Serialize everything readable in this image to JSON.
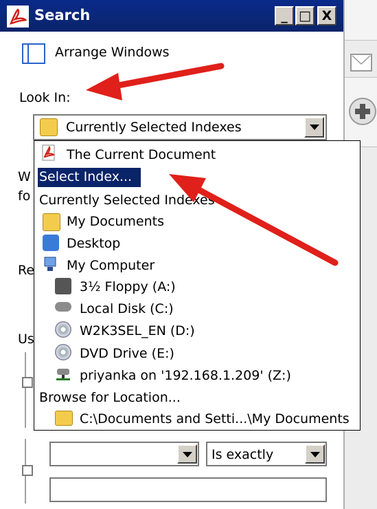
{
  "window": {
    "title": "Search",
    "minimize": "_",
    "maximize": "□",
    "close": "X"
  },
  "panel": {
    "arrange_windows": "Arrange Windows",
    "look_in_label": "Look In:",
    "look_in_value": "Currently Selected Indexes",
    "partial_labels": [
      "W",
      "fo",
      "Re",
      "Us"
    ]
  },
  "dropdown": {
    "items": [
      "The Current Document",
      "Select Index...",
      "Currently Selected Indexes",
      "My Documents",
      "Desktop",
      "My Computer",
      "3½ Floppy (A:)",
      "Local Disk (C:)",
      "W2K3SEL_EN (D:)",
      "DVD Drive (E:)",
      "priyanka on '192.168.1.209' (Z:)",
      "Browse for Location...",
      "C:\\Documents and Setti...\\My Documents"
    ],
    "selected_index": 1
  },
  "criteria": {
    "condition_value": "Is exactly"
  },
  "colors": {
    "titlebar": "#0a246a",
    "selection": "#0a246a",
    "arrow": "#e0201a"
  }
}
